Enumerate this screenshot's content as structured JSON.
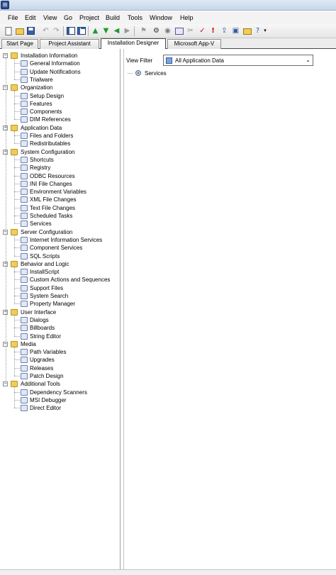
{
  "titlebar": {
    "app_icon": "installshield-app-icon"
  },
  "menu": [
    "File",
    "Edit",
    "View",
    "Go",
    "Project",
    "Build",
    "Tools",
    "Window",
    "Help"
  ],
  "toolbar": {
    "icons": [
      "new-icon",
      "open-icon",
      "save-icon",
      "undo-icon",
      "redo-icon",
      "view-pane-icon",
      "view-pane-alt-icon",
      "up-arrow-icon",
      "down-arrow-icon",
      "back-arrow-icon",
      "forward-arrow-icon",
      "build-icon",
      "settings-icon",
      "compile-icon",
      "release-icon",
      "cut-icon",
      "validate-icon",
      "error-icon",
      "distribute-icon",
      "run-icon",
      "folder-icon",
      "help-icon",
      "overflow-icon"
    ]
  },
  "tabs": [
    "Start Page",
    "Project Assistant",
    "Installation Designer",
    "Microsoft App-V"
  ],
  "active_tab": "Installation Designer",
  "tree": [
    {
      "label": "Installation Information",
      "children": [
        "General Information",
        "Update Notifications",
        "Trialware"
      ]
    },
    {
      "label": "Organization",
      "children": [
        "Setup Design",
        "Features",
        "Components",
        "DIM References"
      ]
    },
    {
      "label": "Application Data",
      "children": [
        "Files and Folders",
        "Redistributables"
      ]
    },
    {
      "label": "System Configuration",
      "children": [
        "Shortcuts",
        "Registry",
        "ODBC Resources",
        "INI File Changes",
        "Environment Variables",
        "XML File Changes",
        "Text File Changes",
        "Scheduled Tasks",
        "Services"
      ]
    },
    {
      "label": "Server Configuration",
      "children": [
        "Internet Information Services",
        "Component Services",
        "SQL Scripts"
      ]
    },
    {
      "label": "Behavior and Logic",
      "children": [
        "InstallScript",
        "Custom Actions and Sequences",
        "Support Files",
        "System Search",
        "Property Manager"
      ]
    },
    {
      "label": "User Interface",
      "children": [
        "Dialogs",
        "Billboards",
        "String Editor"
      ]
    },
    {
      "label": "Media",
      "children": [
        "Path Variables",
        "Upgrades",
        "Releases",
        "Patch Design"
      ]
    },
    {
      "label": "Additional Tools",
      "children": [
        "Dependency Scanners",
        "MSI Debugger",
        "Direct Editor"
      ]
    }
  ],
  "view_filter": {
    "label": "View Filter",
    "selected": "All Application Data"
  },
  "right_tree": {
    "root": "Services"
  },
  "colors": {
    "folder": "#f2cc5a",
    "tab_border": "#4a4a4a",
    "titlebar": "#c6d6ec"
  }
}
